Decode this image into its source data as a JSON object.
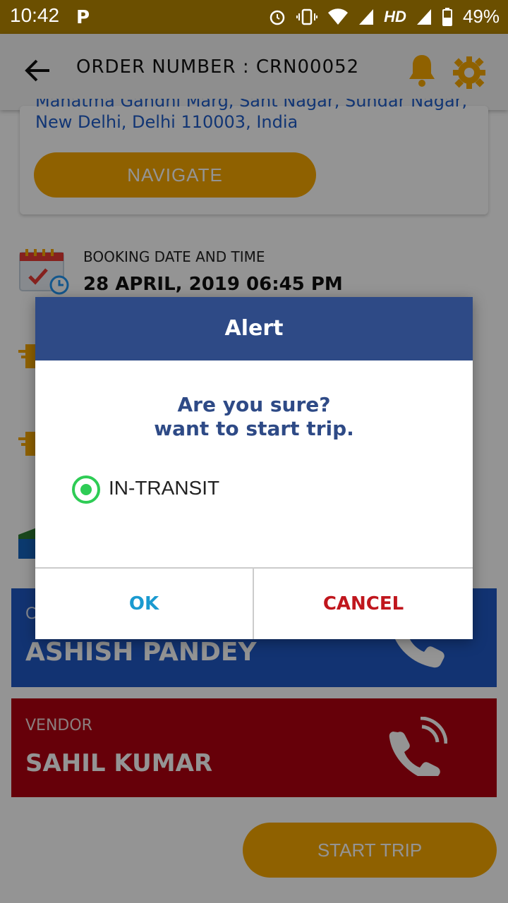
{
  "status_bar": {
    "time": "10:42",
    "app_badge": "P",
    "network": "HD",
    "battery": "49%"
  },
  "app_bar": {
    "title": "ORDER NUMBER : CRN00052"
  },
  "address_card": {
    "address_partial": "Mahatma Gandhi Marg, Sant Nagar, Sundar Nagar,",
    "address": "New Delhi, Delhi 110003, India",
    "navigate_label": "NAVIGATE"
  },
  "booking": {
    "label": "BOOKING DATE AND TIME",
    "value": "28 APRIL, 2019  06:45 PM"
  },
  "customer": {
    "label": "C",
    "name": "ASHISH PANDEY"
  },
  "vendor": {
    "label": "VENDOR",
    "name": "SAHIL KUMAR"
  },
  "start_trip_label": "START TRIP",
  "dialog": {
    "title": "Alert",
    "message_line1": "Are you sure?",
    "message_line2": "want to start trip.",
    "radio_label": "IN-TRANSIT",
    "ok_label": "OK",
    "cancel_label": "CANCEL"
  },
  "colors": {
    "accent": "#f6a800",
    "dialog_header": "#2e4a86",
    "customer_bg": "#1f59c5",
    "vendor_bg": "#b00010",
    "radio_green": "#2ecc55"
  }
}
